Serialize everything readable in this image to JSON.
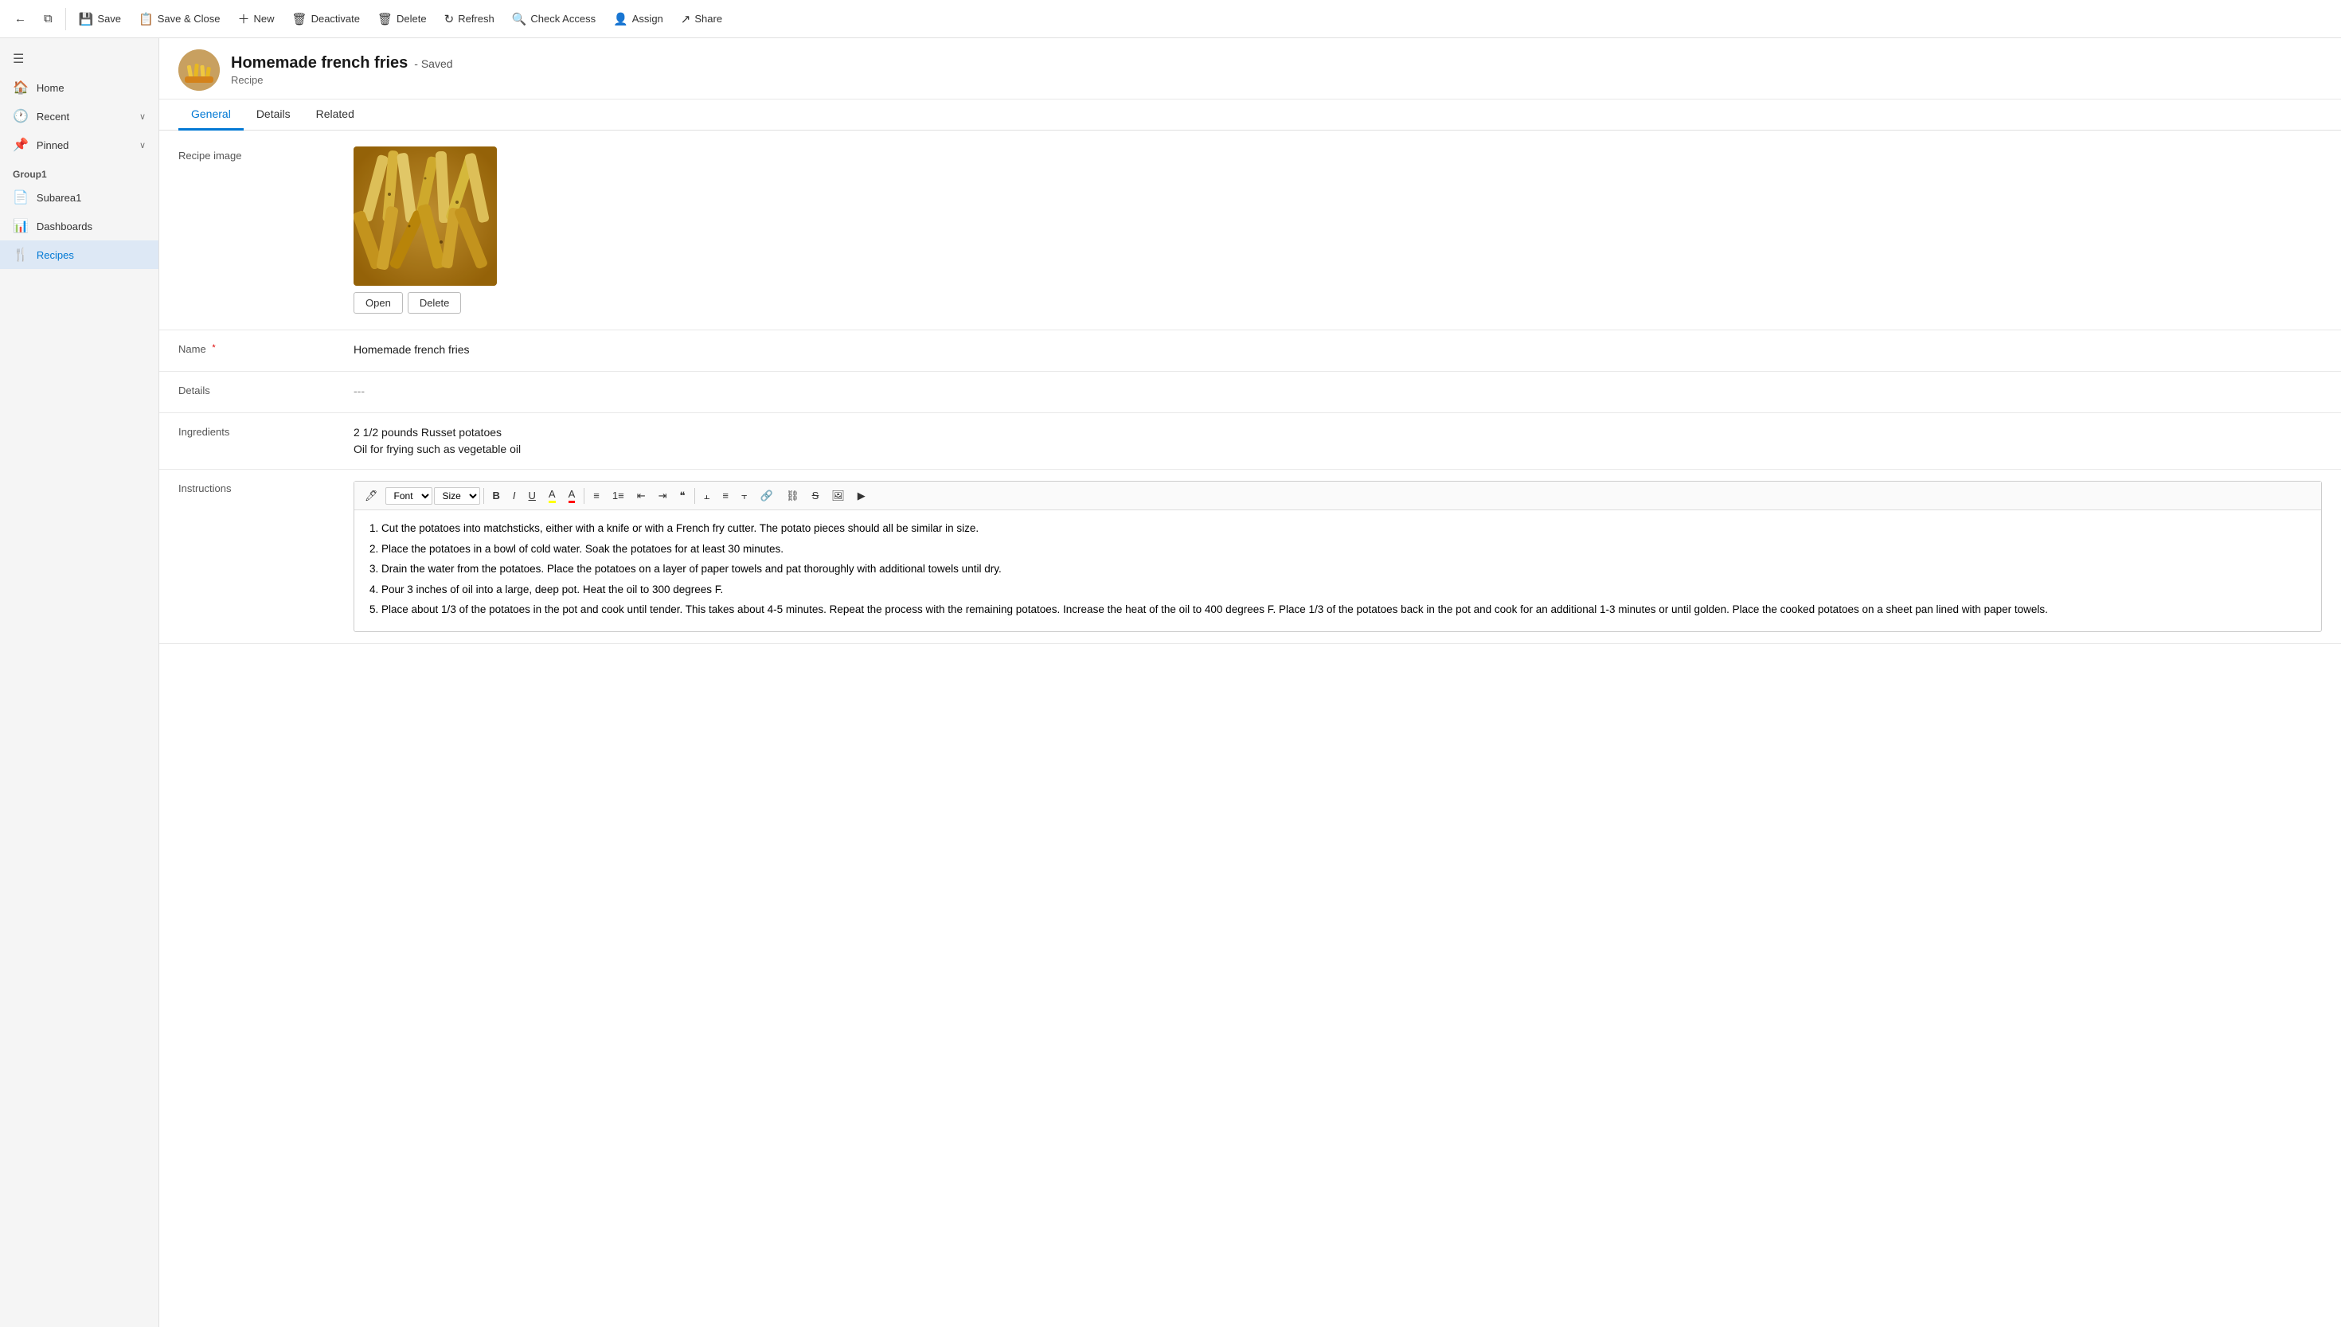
{
  "toolbar": {
    "back_icon": "←",
    "open_icon": "⬜",
    "save_label": "Save",
    "save_close_label": "Save & Close",
    "new_label": "New",
    "deactivate_label": "Deactivate",
    "delete_label": "Delete",
    "refresh_label": "Refresh",
    "check_access_label": "Check Access",
    "assign_label": "Assign",
    "share_label": "Share"
  },
  "sidebar": {
    "menu_icon": "☰",
    "items": [
      {
        "id": "home",
        "label": "Home",
        "icon": "🏠"
      },
      {
        "id": "recent",
        "label": "Recent",
        "icon": "🕐",
        "expand": "∨"
      },
      {
        "id": "pinned",
        "label": "Pinned",
        "icon": "📌",
        "expand": "∨"
      }
    ],
    "group_label": "Group1",
    "group_items": [
      {
        "id": "subarea1",
        "label": "Subarea1",
        "icon": "📄"
      },
      {
        "id": "dashboards",
        "label": "Dashboards",
        "icon": "📊"
      },
      {
        "id": "recipes",
        "label": "Recipes",
        "icon": "🍴",
        "active": true
      }
    ]
  },
  "record": {
    "title": "Homemade french fries",
    "saved_status": "- Saved",
    "record_type": "Recipe",
    "avatar_emoji": "🍟"
  },
  "tabs": [
    {
      "id": "general",
      "label": "General",
      "active": true
    },
    {
      "id": "details",
      "label": "Details"
    },
    {
      "id": "related",
      "label": "Related"
    }
  ],
  "form": {
    "image_label": "Recipe image",
    "open_btn": "Open",
    "delete_btn": "Delete",
    "name_label": "Name",
    "name_value": "Homemade french fries",
    "details_label": "Details",
    "details_value": "---",
    "ingredients_label": "Ingredients",
    "ingredients_line1": "2 1/2 pounds Russet potatoes",
    "ingredients_line2": "Oil for frying such as vegetable oil",
    "instructions_label": "Instructions",
    "rte": {
      "font_label": "Font",
      "size_label": "Size",
      "bold": "B",
      "italic": "I",
      "underline": "U",
      "instructions_items": [
        "Cut the potatoes into matchsticks, either with a knife or with a French fry cutter. The potato pieces should all be similar in size.",
        "Place the potatoes in a bowl of cold water. Soak the potatoes for at least 30 minutes.",
        "Drain the water from the potatoes. Place the potatoes on a layer of paper towels and pat thoroughly with additional towels until dry.",
        "Pour 3 inches of oil into a large, deep pot. Heat the oil to 300 degrees F.",
        "Place about 1/3 of the potatoes in the pot and cook until tender. This takes about 4-5 minutes. Repeat the process with the remaining potatoes. Increase the heat of the oil to 400 degrees F. Place 1/3 of the potatoes back in the pot and cook for an additional 1-3 minutes or until golden. Place the cooked potatoes on a sheet pan lined with paper towels."
      ]
    }
  }
}
